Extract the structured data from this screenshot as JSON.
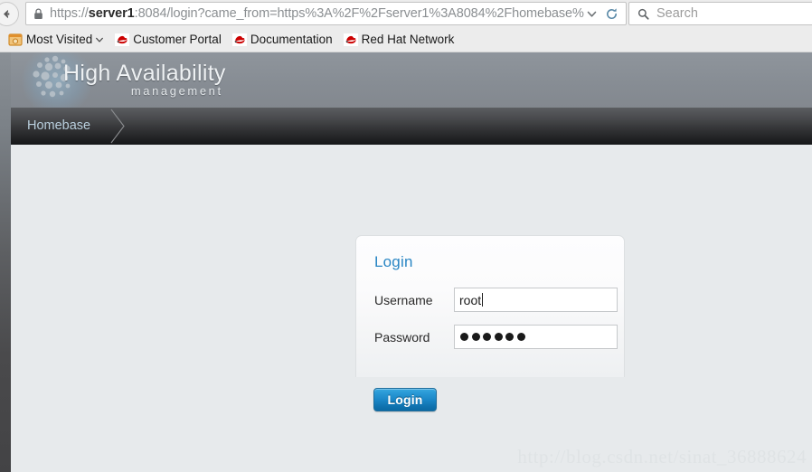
{
  "browser": {
    "back_button": "back-arrow-icon",
    "url": {
      "scheme": "https://",
      "host": "server1",
      "rest": ":8084/login?came_from=https%3A%2F%2Fserver1%3A8084%2Fhomebase%",
      "full": "https://server1:8084/login?came_from=https%3A%2F%2Fserver1%3A8084%2Fhomebase%",
      "lock_icon": "padlock-icon",
      "dropdown_icon": "chevron-down-icon",
      "reload_icon": "reload-icon"
    },
    "search": {
      "placeholder": "Search",
      "icon": "search-icon"
    },
    "bookmarks": [
      {
        "label": "Most Visited",
        "icon": "most-visited-icon",
        "has_chevron": true
      },
      {
        "label": "Customer Portal",
        "icon": "red-hat-icon",
        "has_chevron": false
      },
      {
        "label": "Documentation",
        "icon": "red-hat-icon",
        "has_chevron": false
      },
      {
        "label": "Red Hat Network",
        "icon": "red-hat-icon",
        "has_chevron": false
      }
    ]
  },
  "app": {
    "brand": {
      "title": "High Availability",
      "subtitle": "management",
      "logo_icon": "dot-cluster-logo"
    },
    "nav": {
      "breadcrumb": "Homebase",
      "arrow_icon": "chevron-right-icon"
    },
    "login": {
      "title": "Login",
      "username_label": "Username",
      "username_value": "root",
      "username_placeholder": "",
      "password_label": "Password",
      "password_value": "••••••",
      "password_dots": 6,
      "submit_label": "Login",
      "accent_color": "#2986c4",
      "button_color": "#1a86c6"
    },
    "watermark": "http://blog.csdn.net/sinat_36888624"
  }
}
